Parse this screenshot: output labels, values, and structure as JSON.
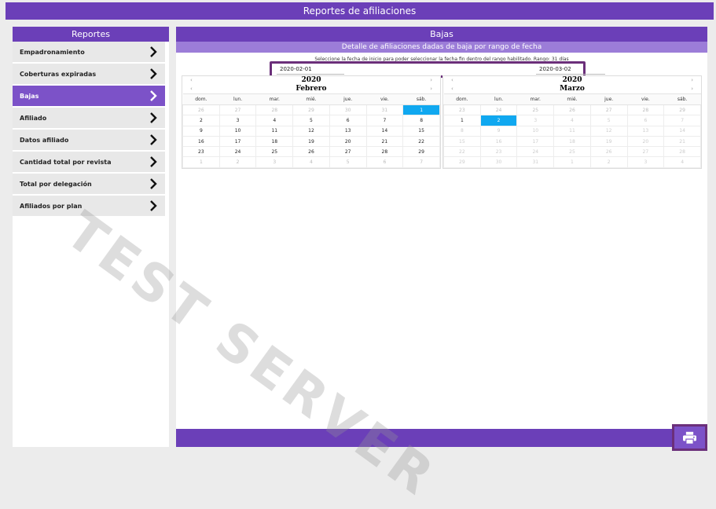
{
  "window": {
    "title": "Reportes de afiliaciones"
  },
  "sidebar": {
    "header": "Reportes",
    "items": [
      {
        "label": "Empadronamiento",
        "active": false
      },
      {
        "label": "Coberturas expiradas",
        "active": false
      },
      {
        "label": "Bajas",
        "active": true
      },
      {
        "label": "Afiliado",
        "active": false
      },
      {
        "label": "Datos afiliado",
        "active": false
      },
      {
        "label": "Cantidad total por revista",
        "active": false
      },
      {
        "label": "Total por delegación",
        "active": false
      },
      {
        "label": "Afiliados por plan",
        "active": false
      }
    ]
  },
  "main": {
    "title": "Bajas",
    "subtitle": "Detalle de afiliaciones dadas de baja por rango de fecha",
    "hint": "Seleccione la fecha de inicio para poder seleccionar la fecha fin dentro del rango habilitado. Rango: 31 días",
    "date_from": "2020-02-01",
    "date_to": "2020-03-02",
    "weekdays": [
      "dom.",
      "lun.",
      "mar.",
      "mié.",
      "jue.",
      "vie.",
      "sáb."
    ],
    "calendars": [
      {
        "year": "2020",
        "month": "Febrero",
        "weeks": [
          [
            {
              "d": "26",
              "s": "out"
            },
            {
              "d": "27",
              "s": "out"
            },
            {
              "d": "28",
              "s": "out"
            },
            {
              "d": "29",
              "s": "out"
            },
            {
              "d": "30",
              "s": "out"
            },
            {
              "d": "31",
              "s": "out"
            },
            {
              "d": "1",
              "s": "sel"
            }
          ],
          [
            {
              "d": "2"
            },
            {
              "d": "3"
            },
            {
              "d": "4"
            },
            {
              "d": "5"
            },
            {
              "d": "6"
            },
            {
              "d": "7"
            },
            {
              "d": "8"
            }
          ],
          [
            {
              "d": "9"
            },
            {
              "d": "10"
            },
            {
              "d": "11"
            },
            {
              "d": "12"
            },
            {
              "d": "13"
            },
            {
              "d": "14"
            },
            {
              "d": "15"
            }
          ],
          [
            {
              "d": "16"
            },
            {
              "d": "17"
            },
            {
              "d": "18"
            },
            {
              "d": "19"
            },
            {
              "d": "20"
            },
            {
              "d": "21"
            },
            {
              "d": "22"
            }
          ],
          [
            {
              "d": "23"
            },
            {
              "d": "24"
            },
            {
              "d": "25"
            },
            {
              "d": "26"
            },
            {
              "d": "27"
            },
            {
              "d": "28"
            },
            {
              "d": "29"
            }
          ],
          [
            {
              "d": "1",
              "s": "out"
            },
            {
              "d": "2",
              "s": "out"
            },
            {
              "d": "3",
              "s": "out"
            },
            {
              "d": "4",
              "s": "out"
            },
            {
              "d": "5",
              "s": "out"
            },
            {
              "d": "6",
              "s": "out"
            },
            {
              "d": "7",
              "s": "out"
            }
          ]
        ]
      },
      {
        "year": "2020",
        "month": "Marzo",
        "weeks": [
          [
            {
              "d": "23",
              "s": "out"
            },
            {
              "d": "24",
              "s": "out"
            },
            {
              "d": "25",
              "s": "out"
            },
            {
              "d": "26",
              "s": "out"
            },
            {
              "d": "27",
              "s": "out"
            },
            {
              "d": "28",
              "s": "out"
            },
            {
              "d": "29",
              "s": "out"
            }
          ],
          [
            {
              "d": "1"
            },
            {
              "d": "2",
              "s": "sel"
            },
            {
              "d": "3",
              "s": "dis"
            },
            {
              "d": "4",
              "s": "dis"
            },
            {
              "d": "5",
              "s": "dis"
            },
            {
              "d": "6",
              "s": "dis"
            },
            {
              "d": "7",
              "s": "dis"
            }
          ],
          [
            {
              "d": "8",
              "s": "dis"
            },
            {
              "d": "9",
              "s": "dis"
            },
            {
              "d": "10",
              "s": "dis"
            },
            {
              "d": "11",
              "s": "dis"
            },
            {
              "d": "12",
              "s": "dis"
            },
            {
              "d": "13",
              "s": "dis"
            },
            {
              "d": "14",
              "s": "dis"
            }
          ],
          [
            {
              "d": "15",
              "s": "dis"
            },
            {
              "d": "16",
              "s": "dis"
            },
            {
              "d": "17",
              "s": "dis"
            },
            {
              "d": "18",
              "s": "dis"
            },
            {
              "d": "19",
              "s": "dis"
            },
            {
              "d": "20",
              "s": "dis"
            },
            {
              "d": "21",
              "s": "dis"
            }
          ],
          [
            {
              "d": "22",
              "s": "dis"
            },
            {
              "d": "23",
              "s": "dis"
            },
            {
              "d": "24",
              "s": "dis"
            },
            {
              "d": "25",
              "s": "dis"
            },
            {
              "d": "26",
              "s": "dis"
            },
            {
              "d": "27",
              "s": "dis"
            },
            {
              "d": "28",
              "s": "dis"
            }
          ],
          [
            {
              "d": "29",
              "s": "dis"
            },
            {
              "d": "30",
              "s": "dis"
            },
            {
              "d": "31",
              "s": "dis"
            },
            {
              "d": "1",
              "s": "dis"
            },
            {
              "d": "2",
              "s": "dis"
            },
            {
              "d": "3",
              "s": "dis"
            },
            {
              "d": "4",
              "s": "dis"
            }
          ]
        ]
      }
    ]
  },
  "watermark": "TEST SERVER",
  "icons": {
    "chevron": "chevron-right-icon",
    "print": "printer-icon"
  },
  "colors": {
    "primary": "#6b3fb8",
    "selected_day": "#10a8f0",
    "highlight_border": "#6b2f7a"
  }
}
